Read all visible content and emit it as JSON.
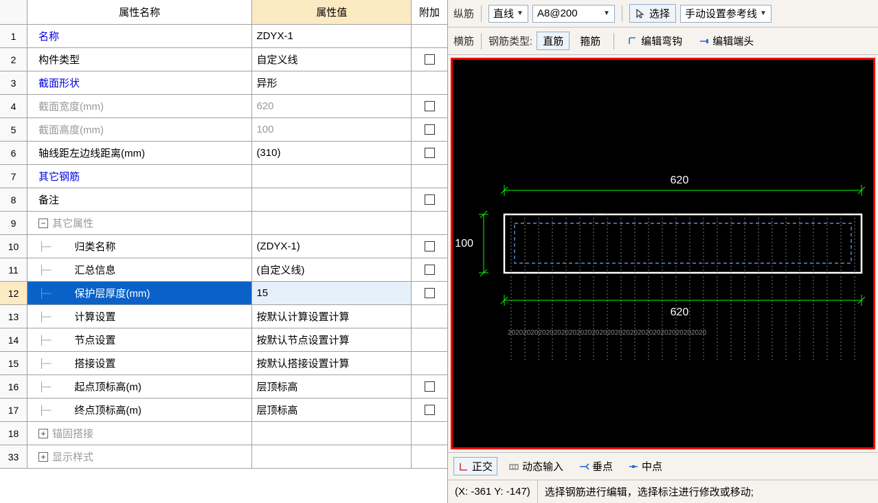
{
  "headers": {
    "name": "属性名称",
    "value": "属性值",
    "ext": "附加"
  },
  "selected_index": 12,
  "rows": [
    {
      "n": "1",
      "name": "名称",
      "val": "ZDYX-1",
      "cls": "blue",
      "cbx": false,
      "indent": 0
    },
    {
      "n": "2",
      "name": "构件类型",
      "val": "自定义线",
      "cls": "",
      "cbx": true,
      "indent": 0
    },
    {
      "n": "3",
      "name": "截面形状",
      "val": "异形",
      "cls": "blue",
      "cbx": false,
      "indent": 0
    },
    {
      "n": "4",
      "name": "截面宽度(mm)",
      "val": "620",
      "cls": "gray",
      "cbx": true,
      "indent": 0
    },
    {
      "n": "5",
      "name": "截面高度(mm)",
      "val": "100",
      "cls": "gray",
      "cbx": true,
      "indent": 0
    },
    {
      "n": "6",
      "name": "轴线距左边线距离(mm)",
      "val": "(310)",
      "cls": "",
      "cbx": true,
      "indent": 0
    },
    {
      "n": "7",
      "name": "其它钢筋",
      "val": "",
      "cls": "blue",
      "cbx": false,
      "indent": 0
    },
    {
      "n": "8",
      "name": "备注",
      "val": "",
      "cls": "",
      "cbx": true,
      "indent": 0
    },
    {
      "n": "9",
      "name": "其它属性",
      "val": "",
      "cls": "gray",
      "cbx": false,
      "indent": 0,
      "toggle": "-"
    },
    {
      "n": "10",
      "name": "归类名称",
      "val": "(ZDYX-1)",
      "cls": "",
      "cbx": true,
      "indent": 1
    },
    {
      "n": "11",
      "name": "汇总信息",
      "val": "(自定义线)",
      "cls": "",
      "cbx": true,
      "indent": 1
    },
    {
      "n": "12",
      "name": "保护层厚度(mm)",
      "val": "15",
      "cls": "",
      "cbx": true,
      "indent": 1
    },
    {
      "n": "13",
      "name": "计算设置",
      "val": "按默认计算设置计算",
      "cls": "",
      "cbx": false,
      "indent": 1
    },
    {
      "n": "14",
      "name": "节点设置",
      "val": "按默认节点设置计算",
      "cls": "",
      "cbx": false,
      "indent": 1
    },
    {
      "n": "15",
      "name": "搭接设置",
      "val": "按默认搭接设置计算",
      "cls": "",
      "cbx": false,
      "indent": 1
    },
    {
      "n": "16",
      "name": "起点顶标高(m)",
      "val": "层顶标高",
      "cls": "",
      "cbx": true,
      "indent": 1
    },
    {
      "n": "17",
      "name": "终点顶标高(m)",
      "val": "层顶标高",
      "cls": "",
      "cbx": true,
      "indent": 1
    },
    {
      "n": "18",
      "name": "锚固搭接",
      "val": "",
      "cls": "gray",
      "cbx": false,
      "indent": 0,
      "toggle": "+"
    },
    {
      "n": "33",
      "name": "显示样式",
      "val": "",
      "cls": "gray",
      "cbx": false,
      "indent": 0,
      "toggle": "+"
    }
  ],
  "toolbar1": {
    "label1": "纵筋",
    "mode": "直线",
    "spec": "A8@200",
    "select_label": "选择",
    "ref_label": "手动设置参考线"
  },
  "toolbar2": {
    "label1": "横筋",
    "type_label": "钢筋类型:",
    "btn1": "直筋",
    "btn2": "箍筋",
    "edit_hook": "编辑弯钩",
    "edit_end": "编辑端头"
  },
  "drawing": {
    "top_dim": "620",
    "left_dim": "100",
    "bottom_dim": "620"
  },
  "bottom_tb": {
    "ortho": "正交",
    "dyn": "动态输入",
    "perp": "垂点",
    "mid": "中点"
  },
  "status": {
    "coord": "(X: -361 Y: -147)",
    "msg": "选择钢筋进行编辑，选择标注进行修改或移动;"
  }
}
